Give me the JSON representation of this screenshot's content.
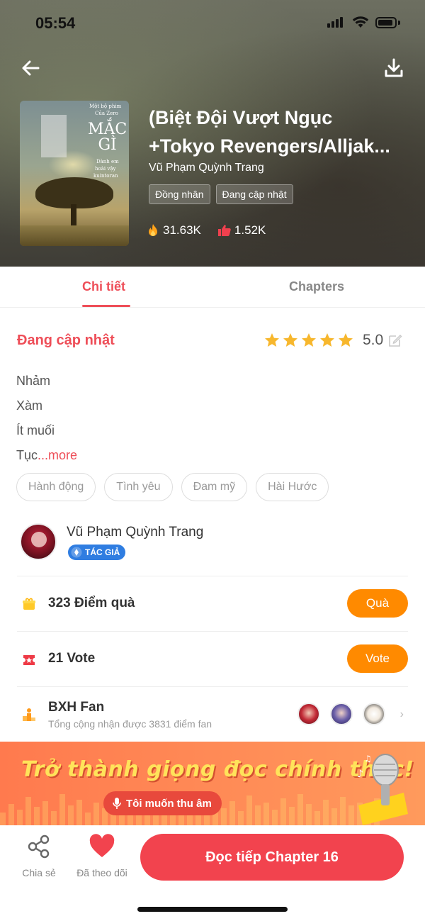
{
  "status_bar": {
    "time": "05:54"
  },
  "header": {
    "back_icon": "arrow-left-icon",
    "download_icon": "download-icon",
    "title_line1": "(Biệt Đội Vượt Ngục",
    "title_line2": "+Tokyo Revengers/Alljak...",
    "author": "Vũ Phạm Quỳnh Trang",
    "tags": [
      "Đồng nhân",
      "Đang cập nhật"
    ],
    "views": "31.63K",
    "likes": "1.52K",
    "cover": {
      "top_text_1": "Một bộ phim",
      "top_text_2": "Của Zero",
      "main_line_1": "MẮC",
      "main_line_2": "GÌ",
      "sub_1": "Dành em",
      "sub_2": "hoài vậy",
      "sub_3": "kuintoran"
    }
  },
  "tabs": {
    "detail": "Chi tiết",
    "chapters": "Chapters"
  },
  "detail": {
    "status": "Đang cập nhật",
    "rating": "5.0",
    "stars": 5,
    "description": [
      "Nhảm",
      "Xàm",
      "Ít muối",
      "Tục"
    ],
    "more": "...more",
    "genres": [
      "Hành động",
      "Tình yêu",
      "Đam mỹ",
      "Hài Hước"
    ]
  },
  "author_block": {
    "name": "Vũ Phạm Quỳnh Trang",
    "badge": "TÁC GIẢ"
  },
  "gift": {
    "label": "323 Điểm quà",
    "button": "Quà"
  },
  "vote": {
    "label": "21 Vote",
    "button": "Vote"
  },
  "fan": {
    "title": "BXH Fan",
    "subtitle": "Tổng cộng nhận được 3831 điểm fan"
  },
  "banner": {
    "title": "Trở thành giọng đọc chính thức!",
    "button": "Tôi muốn thu âm"
  },
  "bottom_bar": {
    "share": "Chia sẻ",
    "follow": "Đã theo dõi",
    "read": "Đọc tiếp Chapter 16"
  },
  "colors": {
    "accent": "#ee4e58",
    "orange": "#ff8a00",
    "star": "#f7b72d"
  }
}
